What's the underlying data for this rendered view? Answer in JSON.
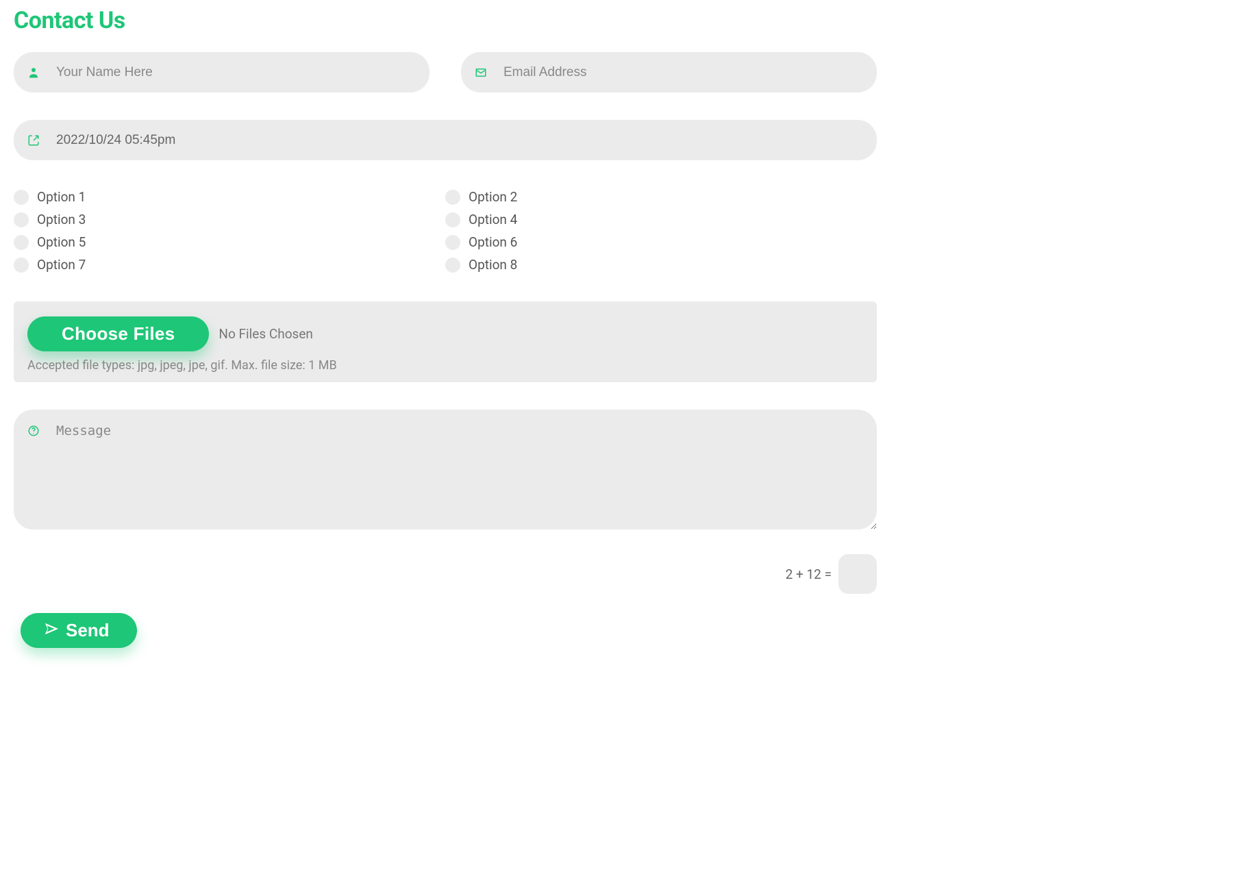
{
  "title": "Contact Us",
  "name": {
    "placeholder": "Your Name Here",
    "value": ""
  },
  "email": {
    "placeholder": "Email Address",
    "value": ""
  },
  "datetime": {
    "value": "2022/10/24 05:45pm"
  },
  "checkboxes": {
    "items": [
      {
        "label": "Option 1"
      },
      {
        "label": "Option 2"
      },
      {
        "label": "Option 3"
      },
      {
        "label": "Option 4"
      },
      {
        "label": "Option 5"
      },
      {
        "label": "Option 6"
      },
      {
        "label": "Option 7"
      },
      {
        "label": "Option 8"
      }
    ]
  },
  "file": {
    "choose_label": "Choose Files",
    "status": "No Files Chosen",
    "hint": "Accepted file types: jpg, jpeg, jpe, gif. Max. file size: 1 MB"
  },
  "message": {
    "placeholder": "Message",
    "value": ""
  },
  "captcha": {
    "question": "2 + 12 =",
    "value": ""
  },
  "send_label": "Send"
}
